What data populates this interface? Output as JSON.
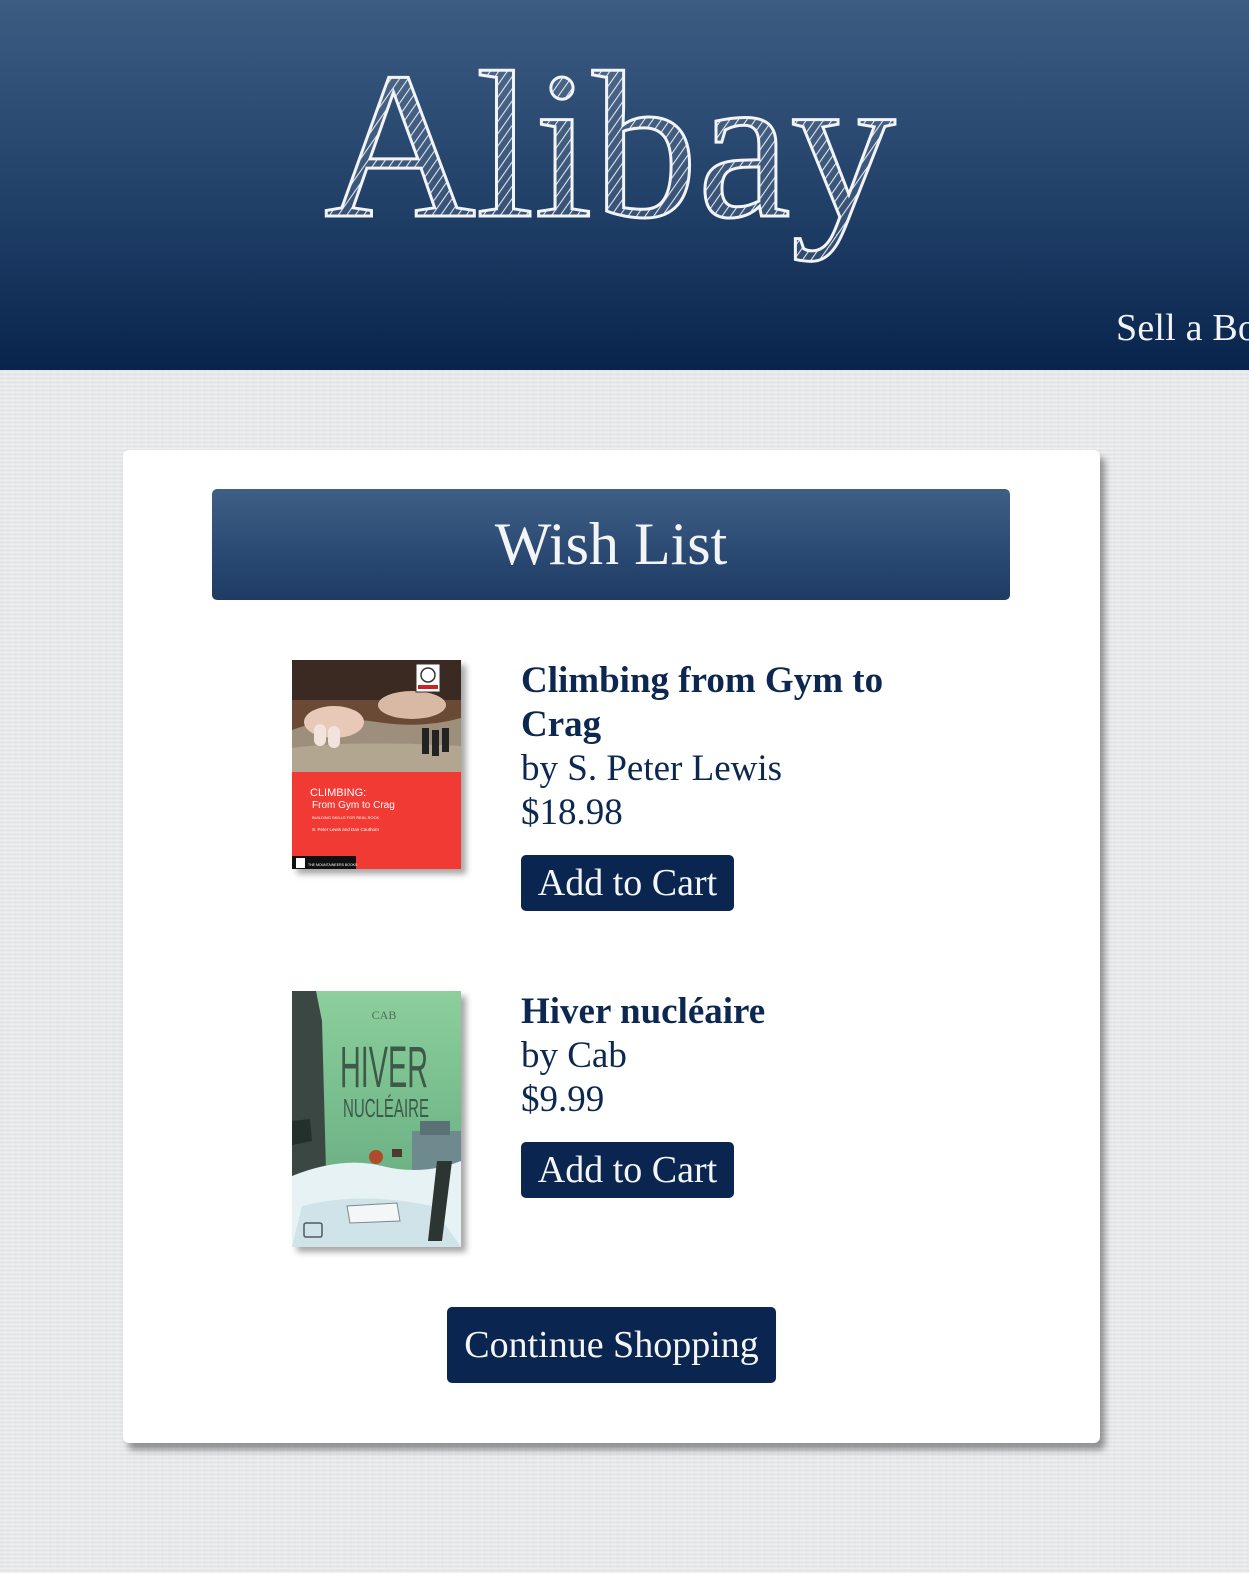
{
  "header": {
    "logo_text": "Alibay",
    "nav_partial": "Sell a Bo"
  },
  "wishlist": {
    "title": "Wish List",
    "items": [
      {
        "title": "Climbing from Gym to Crag",
        "author": "by S. Peter Lewis",
        "price": "$18.98",
        "button_label": "Add to Cart",
        "cover": {
          "heading": "CLIMBING:",
          "subtitle": "From Gym to Crag",
          "tagline": "BUILDING SKILLS FOR REAL ROCK",
          "authors": "S. Peter Lewis and Dan Cauthorn",
          "publisher": "THE MOUNTAINEERS BOOKS"
        }
      },
      {
        "title": "Hiver nucléaire",
        "author": "by Cab",
        "price": "$9.99",
        "button_label": "Add to Cart",
        "cover": {
          "author_mark": "CAB",
          "title_line1": "HIVER",
          "title_line2": "NUCLÉAIRE"
        }
      }
    ],
    "continue_label": "Continue Shopping"
  },
  "colors": {
    "header_top": "#3d5c82",
    "header_bottom": "#08244d",
    "button_bg": "#092550",
    "text_primary": "#0c2850",
    "page_bg": "#e9eaec"
  }
}
